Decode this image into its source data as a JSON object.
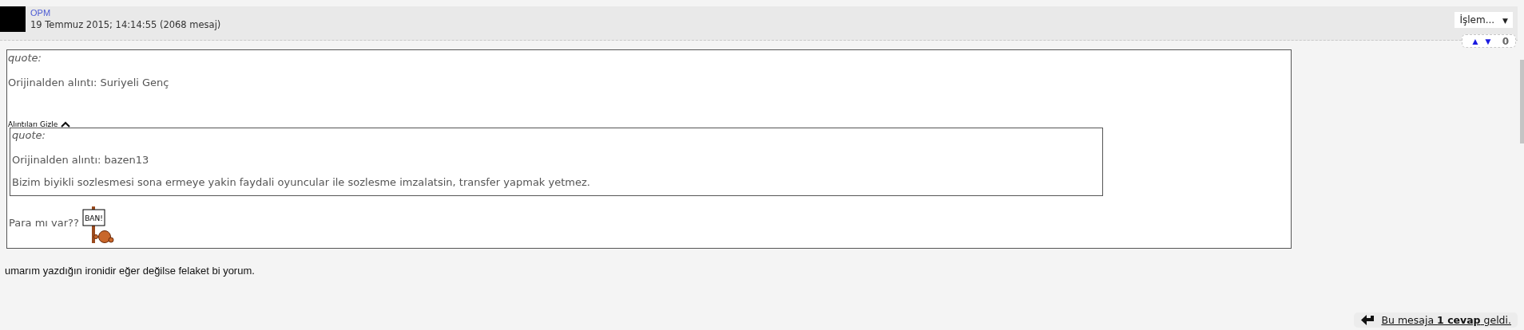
{
  "post": {
    "author": "OPM",
    "meta": "19 Temmuz 2015; 14:14:55 (2068 mesaj)",
    "actions": {
      "label": "İşlem...",
      "caret": "▼"
    },
    "vote": {
      "up": "▲",
      "down": "▼",
      "score": "0"
    },
    "quote": {
      "label": "quote:",
      "source": "Orijinalden alıntı: Suriyeli Genç",
      "toggle": "Alıntıları Gizle",
      "expanded": true,
      "nested": {
        "label": "quote:",
        "source": "Orijinalden alıntı: bazen13",
        "text": "Bizim biyikli sozlesmesi sona ermeye yakin faydali oyuncular ile sozlesme imzalatsin, transfer yapmak yetmez."
      },
      "text": "Para mı var??",
      "emoticon_sign": "BAN!"
    },
    "body": "umarım yazdığın ironidir eğer değilse felaket bi yorum.",
    "replies": "Bu mesaja **1 cevap** geldi."
  }
}
